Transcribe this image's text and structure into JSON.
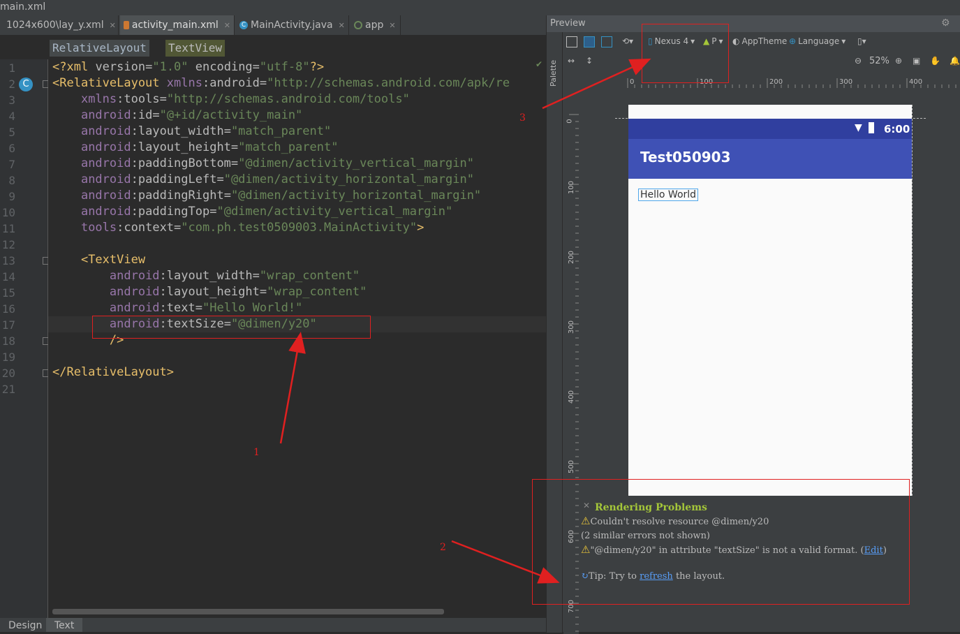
{
  "window": {
    "title": "main.xml"
  },
  "tabs": [
    {
      "label": "1024x600\\lay_y.xml",
      "icon": "xml-file-icon",
      "active": false
    },
    {
      "label": "activity_main.xml",
      "icon": "xml-file-icon",
      "active": true
    },
    {
      "label": "MainActivity.java",
      "icon": "java-class-icon",
      "active": false
    },
    {
      "label": "app",
      "icon": "app-module-icon",
      "active": false
    }
  ],
  "breadcrumbs": [
    "RelativeLayout",
    "TextView"
  ],
  "editor": {
    "line_numbers": [
      "1",
      "2",
      "3",
      "4",
      "5",
      "6",
      "7",
      "8",
      "9",
      "10",
      "11",
      "12",
      "13",
      "14",
      "15",
      "16",
      "17",
      "18",
      "19",
      "20",
      "21"
    ],
    "lines": [
      "<?xml version=\"1.0\" encoding=\"utf-8\"?>",
      "<RelativeLayout xmlns:android=\"http://schemas.android.com/apk/re",
      "    xmlns:tools=\"http://schemas.android.com/tools\"",
      "    android:id=\"@+id/activity_main\"",
      "    android:layout_width=\"match_parent\"",
      "    android:layout_height=\"match_parent\"",
      "    android:paddingBottom=\"@dimen/activity_vertical_margin\"",
      "    android:paddingLeft=\"@dimen/activity_horizontal_margin\"",
      "    android:paddingRight=\"@dimen/activity_horizontal_margin\"",
      "    android:paddingTop=\"@dimen/activity_vertical_margin\"",
      "    tools:context=\"com.ph.test0509003.MainActivity\">",
      "",
      "    <TextView",
      "        android:layout_width=\"wrap_content\"",
      "        android:layout_height=\"wrap_content\"",
      "        android:text=\"Hello World!\"",
      "        android:textSize=\"@dimen/y20\"",
      "        />",
      "",
      "</RelativeLayout>",
      ""
    ]
  },
  "bottom_tabs": [
    "Design",
    "Text"
  ],
  "preview": {
    "title": "Preview",
    "palette_label": "Palette",
    "device": "Nexus 4",
    "api": "P",
    "theme": "AppTheme",
    "language": "Language",
    "zoom": "52%",
    "ruler_h": [
      "0",
      "100",
      "200",
      "300",
      "400"
    ],
    "ruler_v": [
      "0",
      "100",
      "200",
      "300",
      "400",
      "500",
      "600",
      "700"
    ],
    "phone": {
      "time": "6:00",
      "app_title": "Test050903",
      "text_view": "Hello World"
    },
    "problems": {
      "title": "Rendering Problems",
      "line1": "Couldn't resolve resource @dimen/y20",
      "line2": "(2 similar errors not shown)",
      "line3": "\"@dimen/y20\" in attribute \"textSize\" is not a valid format.",
      "line3_link_open": "(",
      "line3_link": "Edit",
      "line3_link_close": ")",
      "tip_prefix": "Tip: Try to",
      "tip_link": "refresh",
      "tip_suffix": "the layout."
    }
  },
  "annotations": {
    "label1": "1",
    "label2": "2",
    "label3": "3",
    "color": "#e02020"
  },
  "colors": {
    "editor_bg": "#2b2b2b",
    "tag": "#e8bf6a",
    "namespace": "#9876aa",
    "value": "#6a8759",
    "app_bar": "#3f51b5",
    "status_bar": "#303f9f"
  }
}
